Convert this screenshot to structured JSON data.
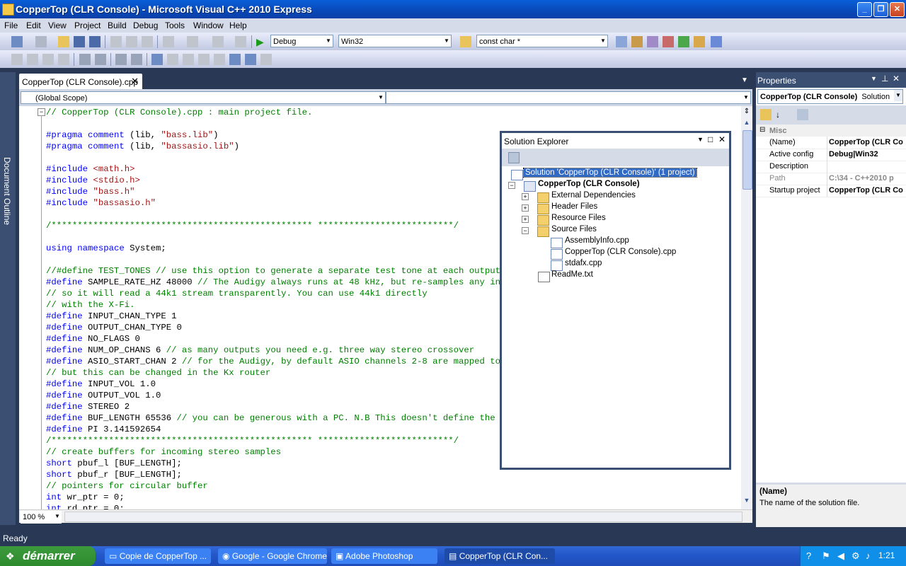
{
  "window": {
    "title": "CopperTop (CLR Console) - Microsoft Visual C++ 2010 Express",
    "minimize": "_",
    "maximize": "❐",
    "close": "✕"
  },
  "menu": [
    "File",
    "Edit",
    "View",
    "Project",
    "Build",
    "Debug",
    "Tools",
    "Window",
    "Help"
  ],
  "toolbar": {
    "config": "Debug",
    "platform": "Win32",
    "find": "const char *"
  },
  "doc_outline": {
    "label": "Document Outline"
  },
  "editor": {
    "tab_label": "CopperTop (CLR Console).cpp",
    "scope_left": "(Global Scope)",
    "scope_right": "",
    "zoom": "100 %",
    "lines": [
      {
        "parts": [
          {
            "t": "// CopperTop (CLR Console).cpp : main project file.",
            "c": "cm"
          }
        ]
      },
      {
        "parts": []
      },
      {
        "parts": [
          {
            "t": "#pragma",
            "c": "kw"
          },
          {
            "t": " "
          },
          {
            "t": "comment",
            "c": "kw"
          },
          {
            "t": " (lib, "
          },
          {
            "t": "\"bass.lib\"",
            "c": "st"
          },
          {
            "t": ")"
          }
        ]
      },
      {
        "parts": [
          {
            "t": "#pragma",
            "c": "kw"
          },
          {
            "t": " "
          },
          {
            "t": "comment",
            "c": "kw"
          },
          {
            "t": " (lib, "
          },
          {
            "t": "\"bassasio.lib\"",
            "c": "st"
          },
          {
            "t": ")"
          }
        ]
      },
      {
        "parts": []
      },
      {
        "parts": [
          {
            "t": "#include",
            "c": "kw"
          },
          {
            "t": " "
          },
          {
            "t": "<math.h>",
            "c": "st"
          }
        ]
      },
      {
        "parts": [
          {
            "t": "#include",
            "c": "kw"
          },
          {
            "t": " "
          },
          {
            "t": "<stdio.h>",
            "c": "st"
          }
        ]
      },
      {
        "parts": [
          {
            "t": "#include",
            "c": "kw"
          },
          {
            "t": " "
          },
          {
            "t": "\"bass.h\"",
            "c": "st"
          }
        ]
      },
      {
        "parts": [
          {
            "t": "#include",
            "c": "kw"
          },
          {
            "t": " "
          },
          {
            "t": "\"bassasio.h\"",
            "c": "st"
          }
        ]
      },
      {
        "parts": []
      },
      {
        "parts": [
          {
            "t": "/************************************************** **************************/",
            "c": "cm"
          }
        ]
      },
      {
        "parts": []
      },
      {
        "parts": [
          {
            "t": "using",
            "c": "kw"
          },
          {
            "t": " "
          },
          {
            "t": "namespace",
            "c": "kw"
          },
          {
            "t": " System;"
          }
        ]
      },
      {
        "parts": []
      },
      {
        "parts": [
          {
            "t": "//#define TEST_TONES // use this option to generate a separate test tone at each output",
            "c": "cm"
          }
        ]
      },
      {
        "parts": [
          {
            "t": "#define",
            "c": "kw"
          },
          {
            "t": " SAMPLE_RATE_HZ 48000 "
          },
          {
            "t": "// The Audigy always runs at 48 kHz, but re-samples any incomin",
            "c": "cm"
          }
        ]
      },
      {
        "parts": [
          {
            "t": "// so it will read a 44k1 stream transparently. You can use 44k1 directly",
            "c": "cm"
          }
        ]
      },
      {
        "parts": [
          {
            "t": "// with the X-Fi.",
            "c": "cm"
          }
        ]
      },
      {
        "parts": [
          {
            "t": "#define",
            "c": "kw"
          },
          {
            "t": " INPUT_CHAN_TYPE 1"
          }
        ]
      },
      {
        "parts": [
          {
            "t": "#define",
            "c": "kw"
          },
          {
            "t": " OUTPUT_CHAN_TYPE 0"
          }
        ]
      },
      {
        "parts": [
          {
            "t": "#define",
            "c": "kw"
          },
          {
            "t": " NO_FLAGS 0"
          }
        ]
      },
      {
        "parts": [
          {
            "t": "#define",
            "c": "kw"
          },
          {
            "t": " NUM_OP_CHANS 6 "
          },
          {
            "t": "// as many outputs you need e.g. three way stereo crossover",
            "c": "cm"
          }
        ]
      },
      {
        "parts": [
          {
            "t": "#define",
            "c": "kw"
          },
          {
            "t": " ASIO_START_CHAN 2 "
          },
          {
            "t": "// for the Audigy, by default ASIO channels 2-8 are mapped to phys",
            "c": "cm"
          }
        ]
      },
      {
        "parts": [
          {
            "t": "// but this can be changed in the Kx router",
            "c": "cm"
          }
        ]
      },
      {
        "parts": [
          {
            "t": "#define",
            "c": "kw"
          },
          {
            "t": " INPUT_VOL 1.0"
          }
        ]
      },
      {
        "parts": [
          {
            "t": "#define",
            "c": "kw"
          },
          {
            "t": " OUTPUT_VOL 1.0"
          }
        ]
      },
      {
        "parts": [
          {
            "t": "#define",
            "c": "kw"
          },
          {
            "t": " STEREO 2"
          }
        ]
      },
      {
        "parts": [
          {
            "t": "#define",
            "c": "kw"
          },
          {
            "t": " BUF_LENGTH 65536 "
          },
          {
            "t": "// you can be generous with a PC. N.B This doesn't define the later",
            "c": "cm"
          }
        ]
      },
      {
        "parts": [
          {
            "t": "#define",
            "c": "kw"
          },
          {
            "t": " PI 3.141592654"
          }
        ]
      },
      {
        "parts": [
          {
            "t": "/************************************************** **************************/",
            "c": "cm"
          }
        ]
      },
      {
        "parts": [
          {
            "t": "// create buffers for incoming stereo samples",
            "c": "cm"
          }
        ]
      },
      {
        "parts": [
          {
            "t": "short",
            "c": "kw"
          },
          {
            "t": " pbuf_l [BUF_LENGTH];"
          }
        ]
      },
      {
        "parts": [
          {
            "t": "short",
            "c": "kw"
          },
          {
            "t": " pbuf_r [BUF_LENGTH];"
          }
        ]
      },
      {
        "parts": [
          {
            "t": "// pointers for circular buffer",
            "c": "cm"
          }
        ]
      },
      {
        "parts": [
          {
            "t": "int",
            "c": "kw"
          },
          {
            "t": " wr_ptr = 0;"
          }
        ]
      },
      {
        "parts": [
          {
            "t": "int",
            "c": "kw"
          },
          {
            "t": " rd_ptr = 0;"
          }
        ]
      }
    ]
  },
  "solution_explorer": {
    "title": "Solution Explorer",
    "solution": "Solution 'CopperTop (CLR Console)' (1 project)",
    "project": "CopperTop (CLR Console)",
    "folders": [
      "External Dependencies",
      "Header Files",
      "Resource Files",
      "Source Files"
    ],
    "source_files": [
      "AssemblyInfo.cpp",
      "CopperTop (CLR Console).cpp",
      "stdafx.cpp"
    ],
    "readme": "ReadMe.txt"
  },
  "properties": {
    "title": "Properties",
    "object": "CopperTop (CLR Console)",
    "object_type": "Solution",
    "category": "Misc",
    "rows": [
      {
        "name": "(Name)",
        "value": "CopperTop (CLR Co"
      },
      {
        "name": "Active config",
        "value": "Debug|Win32"
      },
      {
        "name": "Description",
        "value": ""
      },
      {
        "name": "Path",
        "value": "C:\\34 - C++2010 p"
      },
      {
        "name": "Startup project",
        "value": "CopperTop (CLR Co"
      }
    ],
    "desc_title": "(Name)",
    "desc_text": "The name of the solution file."
  },
  "status": {
    "text": "Ready"
  },
  "taskbar": {
    "start": "démarrer",
    "tasks": [
      "Copie de CopperTop ...",
      "Google - Google Chrome",
      "Adobe Photoshop",
      "CopperTop (CLR Con..."
    ],
    "clock": "1:21"
  }
}
